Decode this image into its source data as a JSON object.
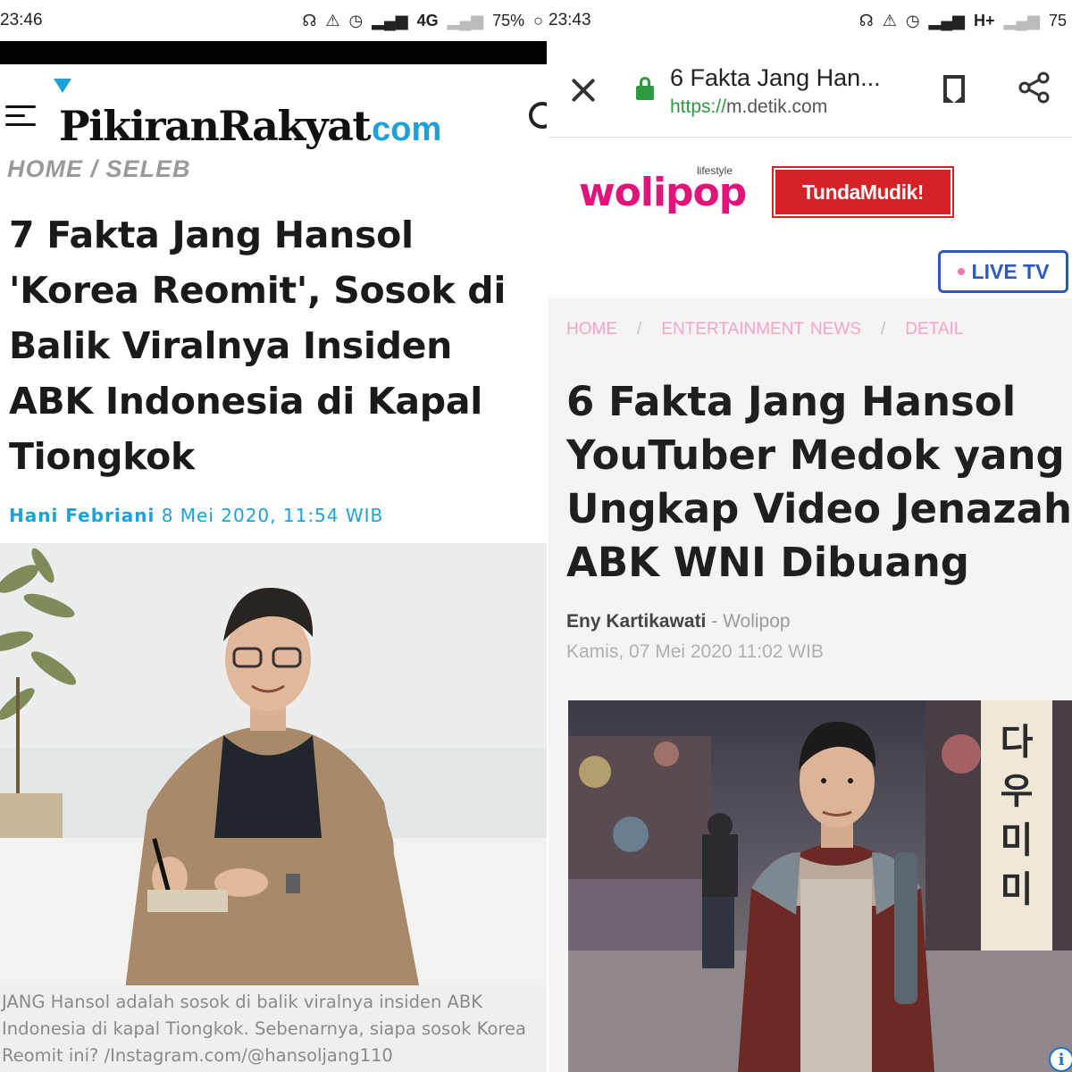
{
  "left": {
    "status_bar": {
      "time": "23:46",
      "network": "4G",
      "battery": "75%"
    },
    "site": {
      "logo_main": "PikiranRakyat",
      "logo_suffix": "com"
    },
    "breadcrumb": "HOME / SELEB",
    "article": {
      "title": "7 Fakta Jang Hansol 'Korea Reomit', Sosok di Balik Viralnya Insiden ABK Indonesia di Kapal Tiongkok",
      "author": "Hani Febriani",
      "date": "8 Mei 2020, 11:54 WIB",
      "caption": "JANG Hansol adalah sosok di balik viralnya insiden ABK Indonesia di kapal Tiongkok. Sebenarnya, siapa sosok Korea Reomit ini? /Instagram.com/@hansoljang110"
    },
    "colors": {
      "brand": "#1da1d8"
    },
    "icons": [
      "menu-icon",
      "search-icon"
    ]
  },
  "right": {
    "status_bar": {
      "time": "23:43",
      "network": "H+",
      "battery": "75"
    },
    "browser": {
      "page_title": "6 Fakta Jang Han...",
      "url_scheme": "https://",
      "url_host": "m.detik.com"
    },
    "site": {
      "logo_tag": "lifestyle",
      "logo": "wolipop",
      "campaign": "TundaMudik!"
    },
    "live_tv": "LIVE TV",
    "breadcrumb": [
      "HOME",
      "ENTERTAINMENT NEWS",
      "DETAIL"
    ],
    "article": {
      "title": "6 Fakta Jang Hansol YouTuber Medok yang Ungkap Video Jenazah ABK WNI Dibuang",
      "author": "Eny Kartikawati",
      "source": "- Wolipop",
      "date": "Kamis, 07 Mei 2020 11:02 WIB"
    },
    "colors": {
      "brand": "#e0147a",
      "live": "#2d5bbd",
      "campaign": "#d62127"
    },
    "icons": [
      "close-icon",
      "lock-icon",
      "bookmark-icon",
      "share-icon",
      "info-icon"
    ]
  }
}
